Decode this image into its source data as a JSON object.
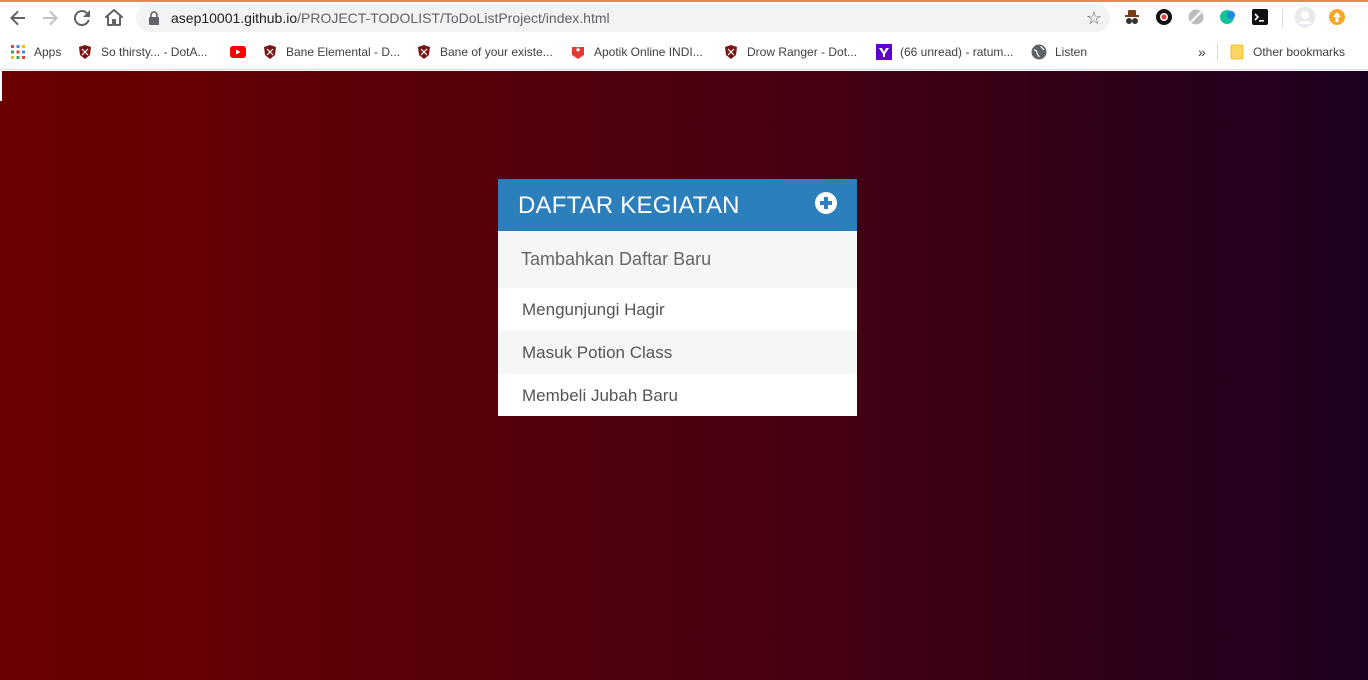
{
  "browser": {
    "url_host": "asep10001.github.io",
    "url_path": "/PROJECT-TODOLIST/ToDoListProject/index.html"
  },
  "bookmarks": {
    "items": [
      {
        "label": "Apps",
        "icon": "apps-grid-icon"
      },
      {
        "label": "So thirsty... - DotA...",
        "icon": "dota-icon"
      },
      {
        "label": "",
        "icon": "youtube-icon"
      },
      {
        "label": "Bane Elemental - D...",
        "icon": "dota-icon"
      },
      {
        "label": "Bane of your existe...",
        "icon": "dota-icon"
      },
      {
        "label": "Apotik Online INDI...",
        "icon": "pharmacy-icon"
      },
      {
        "label": "Drow Ranger - Dot...",
        "icon": "dota-icon"
      },
      {
        "label": "(66 unread) - ratum...",
        "icon": "yahoo-icon"
      },
      {
        "label": "Listen",
        "icon": "globe-icon"
      }
    ],
    "overflow": "»",
    "other": "Other bookmarks"
  },
  "app": {
    "title": "DAFTAR KEGIATAN",
    "input_placeholder": "Tambahkan Daftar Baru",
    "todos": [
      "Mengunjungi Hagir",
      "Masuk Potion Class",
      "Membeli Jubah Baru"
    ]
  },
  "colors": {
    "header": "#2b7fba",
    "gradient_start": "#6b0000",
    "gradient_end": "#1c0020"
  }
}
